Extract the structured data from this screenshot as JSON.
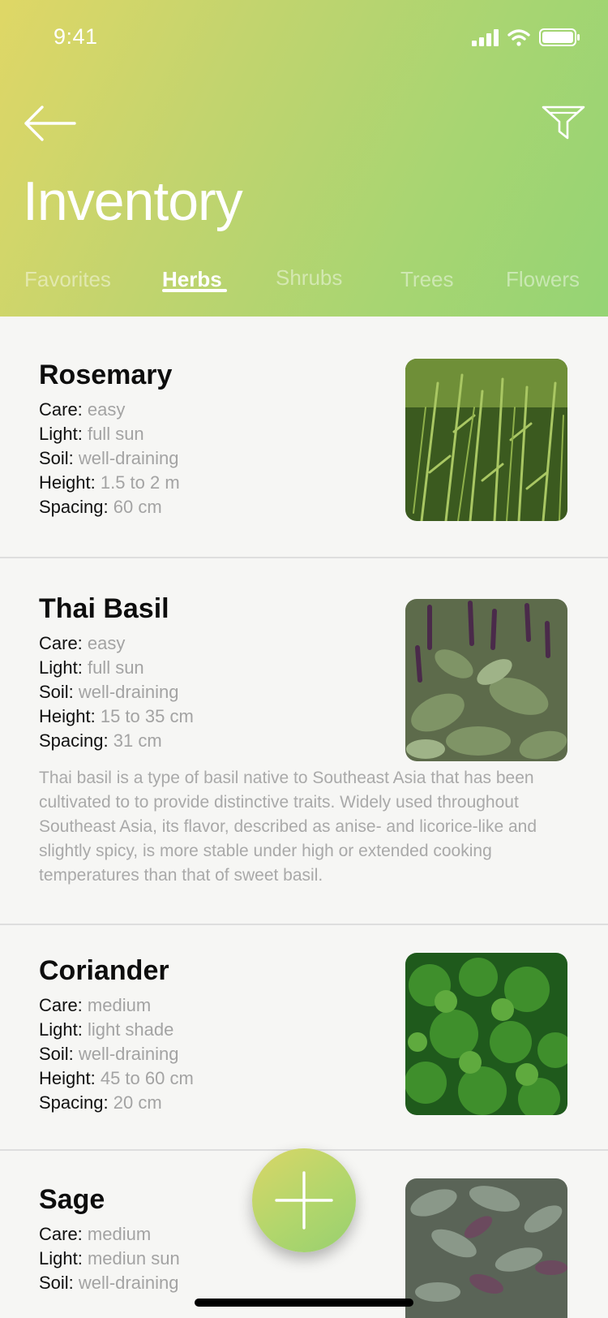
{
  "status_bar": {
    "time": "9:41"
  },
  "header": {
    "title": "Inventory"
  },
  "tabs": [
    {
      "label": "Favorites"
    },
    {
      "label": "Herbs"
    },
    {
      "label": "Shrubs"
    },
    {
      "label": "Trees"
    },
    {
      "label": "Flowers"
    }
  ],
  "active_tab": "Herbs",
  "labels": {
    "care": "Care:",
    "light": "Light:",
    "soil": "Soil:",
    "height": "Height:",
    "spacing": "Spacing:"
  },
  "plants": [
    {
      "name": "Rosemary",
      "care": "easy",
      "light": "full sun",
      "soil": "well-draining",
      "height": "1.5 to 2 m",
      "spacing": "60 cm"
    },
    {
      "name": "Thai Basil",
      "care": "easy",
      "light": "full sun",
      "soil": "well-draining",
      "height": "15 to 35 cm",
      "spacing": "31 cm",
      "description": "Thai basil is a type of basil native to Southeast Asia that has been cultivated to to provide distinctive traits. Widely used throughout Southeast Asia, its flavor, described as anise- and licorice-like and slightly spicy, is more stable under high or extended cooking temperatures than that of sweet basil."
    },
    {
      "name": "Coriander",
      "care": "medium",
      "light": "light shade",
      "soil": "well-draining",
      "height": "45 to 60 cm",
      "spacing": "20 cm"
    },
    {
      "name": "Sage",
      "care": "medium",
      "light": "mediun sun",
      "soil": "well-draining"
    }
  ],
  "colors": {
    "header_gradient_start": "#dfd766",
    "header_gradient_end": "#95d474",
    "value_text": "#a3a3a3"
  },
  "icons": {
    "back": "arrow-left-icon",
    "filter": "filter-funnel-icon",
    "add": "plus-icon"
  }
}
